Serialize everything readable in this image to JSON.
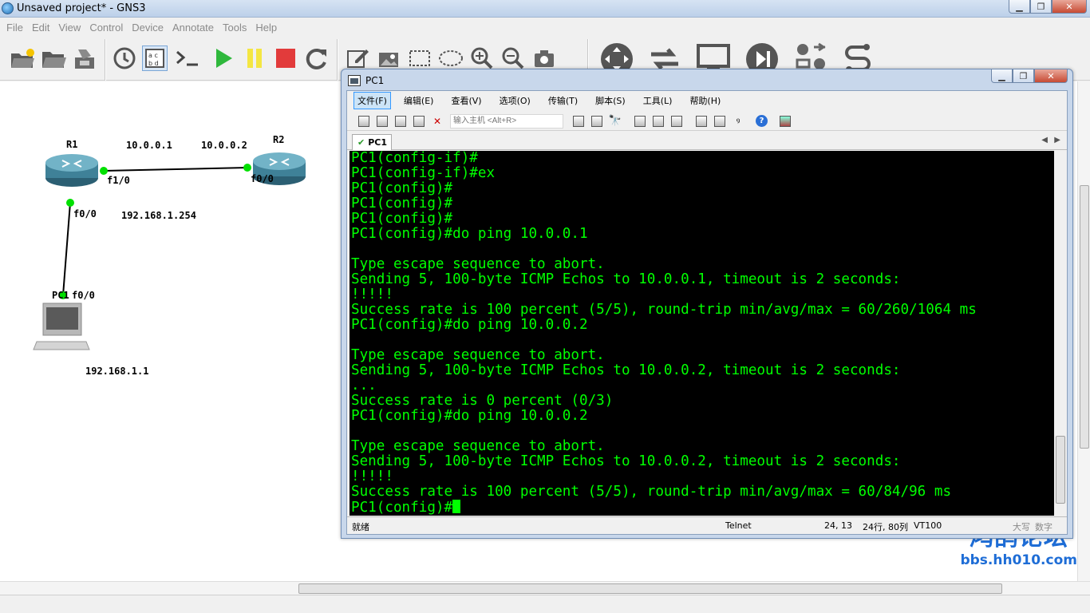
{
  "window": {
    "title": "Unsaved project* - GNS3"
  },
  "menu": [
    "File",
    "Edit",
    "View",
    "Control",
    "Device",
    "Annotate",
    "Tools",
    "Help"
  ],
  "toolbar_icons": [
    "open-project-icon",
    "open-folder-icon",
    "save-icon",
    "history-icon",
    "show-interface-labels-icon",
    "console-icon",
    "start-icon",
    "suspend-icon",
    "stop-icon",
    "reload-icon",
    "add-note-icon",
    "insert-picture-icon",
    "draw-rectangle-icon",
    "draw-ellipse-icon",
    "zoom-in-icon",
    "zoom-out-icon",
    "screenshot-icon",
    "router-icon",
    "switch-icon",
    "end-device-icon",
    "security-device-icon",
    "all-devices-icon",
    "add-link-icon"
  ],
  "topology": {
    "nodes": {
      "r1": "R1",
      "r2": "R2",
      "pc1": "PC1"
    },
    "labels": {
      "r1_ip": "10.0.0.1",
      "r2_ip": "10.0.0.2",
      "r1_f10": "f1/0",
      "r2_f00": "f0/0",
      "r1_f00": "f0/0",
      "r1_lan_ip": "192.168.1.254",
      "pc1_f00": "f0/0",
      "pc1_ip": "192.168.1.1"
    }
  },
  "terminal": {
    "title": "PC1",
    "menu": [
      "文件(F)",
      "编辑(E)",
      "查看(V)",
      "选项(O)",
      "传输(T)",
      "脚本(S)",
      "工具(L)",
      "帮助(H)"
    ],
    "host_placeholder": "输入主机 <Alt+R>",
    "tab": "PC1",
    "lines": [
      "PC1(config-if)#",
      "PC1(config-if)#ex",
      "PC1(config)#",
      "PC1(config)#",
      "PC1(config)#",
      "PC1(config)#do ping 10.0.0.1",
      "",
      "Type escape sequence to abort.",
      "Sending 5, 100-byte ICMP Echos to 10.0.0.1, timeout is 2 seconds:",
      "!!!!!",
      "Success rate is 100 percent (5/5), round-trip min/avg/max = 60/260/1064 ms",
      "PC1(config)#do ping 10.0.0.2",
      "",
      "Type escape sequence to abort.",
      "Sending 5, 100-byte ICMP Echos to 10.0.0.2, timeout is 2 seconds:",
      "...",
      "Success rate is 0 percent (0/3)",
      "PC1(config)#do ping 10.0.0.2",
      "",
      "Type escape sequence to abort.",
      "Sending 5, 100-byte ICMP Echos to 10.0.0.2, timeout is 2 seconds:",
      "!!!!!",
      "Success rate is 100 percent (5/5), round-trip min/avg/max = 60/84/96 ms"
    ],
    "prompt": "PC1(config)#",
    "status": {
      "ready": "就绪",
      "protocol": "Telnet",
      "cursor": "24, 13",
      "size": "24行, 80列",
      "emulation": "VT100",
      "caps": "大写",
      "num": "数字"
    }
  },
  "watermark": {
    "name": "鸿鹄论坛",
    "url": "bbs.hh010.com"
  },
  "colors": {
    "terminal_text": "#00ff00",
    "terminal_bg": "#000000",
    "link_dot": "#00e000"
  }
}
